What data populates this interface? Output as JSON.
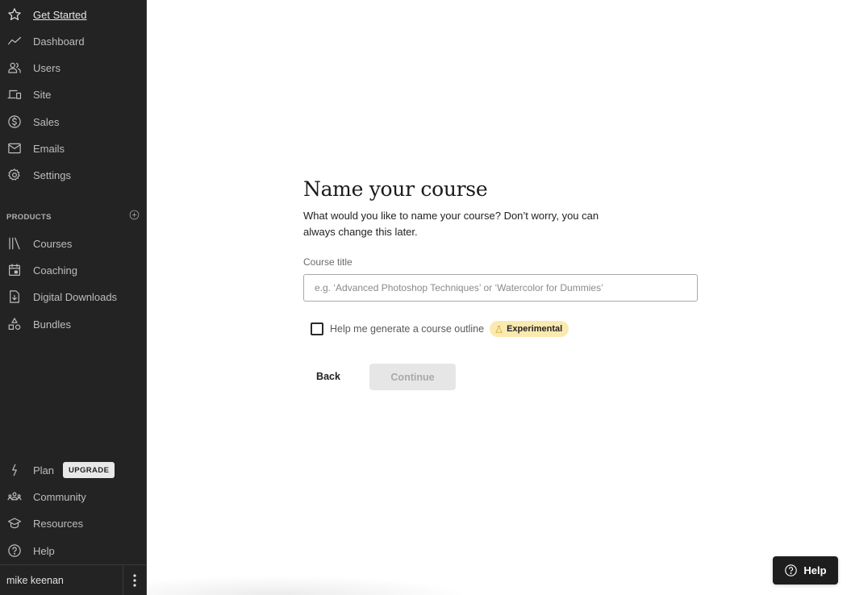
{
  "sidebar": {
    "nav_items": [
      {
        "label": "Get Started",
        "icon": "star-icon",
        "active": true
      },
      {
        "label": "Dashboard",
        "icon": "trend-line-icon"
      },
      {
        "label": "Users",
        "icon": "users-icon"
      },
      {
        "label": "Site",
        "icon": "devices-icon"
      },
      {
        "label": "Sales",
        "icon": "dollar-circle-icon"
      },
      {
        "label": "Emails",
        "icon": "envelope-icon"
      },
      {
        "label": "Settings",
        "icon": "gear-icon"
      }
    ],
    "products_section": {
      "title": "PRODUCTS",
      "add_icon": "plus-circle-icon",
      "items": [
        {
          "label": "Courses",
          "icon": "library-icon"
        },
        {
          "label": "Coaching",
          "icon": "calendar-icon"
        },
        {
          "label": "Digital Downloads",
          "icon": "file-download-icon"
        },
        {
          "label": "Bundles",
          "icon": "shapes-icon"
        }
      ]
    },
    "bottom_items": [
      {
        "label": "Plan",
        "icon": "lightning-icon",
        "badge": "UPGRADE"
      },
      {
        "label": "Community",
        "icon": "community-icon"
      },
      {
        "label": "Resources",
        "icon": "graduation-cap-icon"
      },
      {
        "label": "Help",
        "icon": "question-circle-icon"
      }
    ],
    "user": {
      "name": "mike keenan",
      "menu_icon": "kebab-menu-icon"
    }
  },
  "main": {
    "title": "Name your course",
    "description": "What would you like to name your course? Don’t worry, you can always change this later.",
    "course_title_field": {
      "label": "Course title",
      "value": "",
      "placeholder": "e.g. ‘Advanced Photoshop Techniques’ or ‘Watercolor for Dummies’"
    },
    "outline_checkbox": {
      "label": "Help me generate a course outline",
      "checked": false,
      "badge": "Experimental",
      "badge_icon": "flask-icon"
    },
    "back_label": "Back",
    "continue_label": "Continue",
    "continue_disabled": true
  },
  "help_button": {
    "label": "Help",
    "icon": "question-circle-icon"
  },
  "colors": {
    "sidebar_bg": "#232323",
    "badge_bg": "#fbeab0",
    "disabled_button_bg": "#e6e6e6",
    "help_fab_bg": "#1e1e1e"
  }
}
